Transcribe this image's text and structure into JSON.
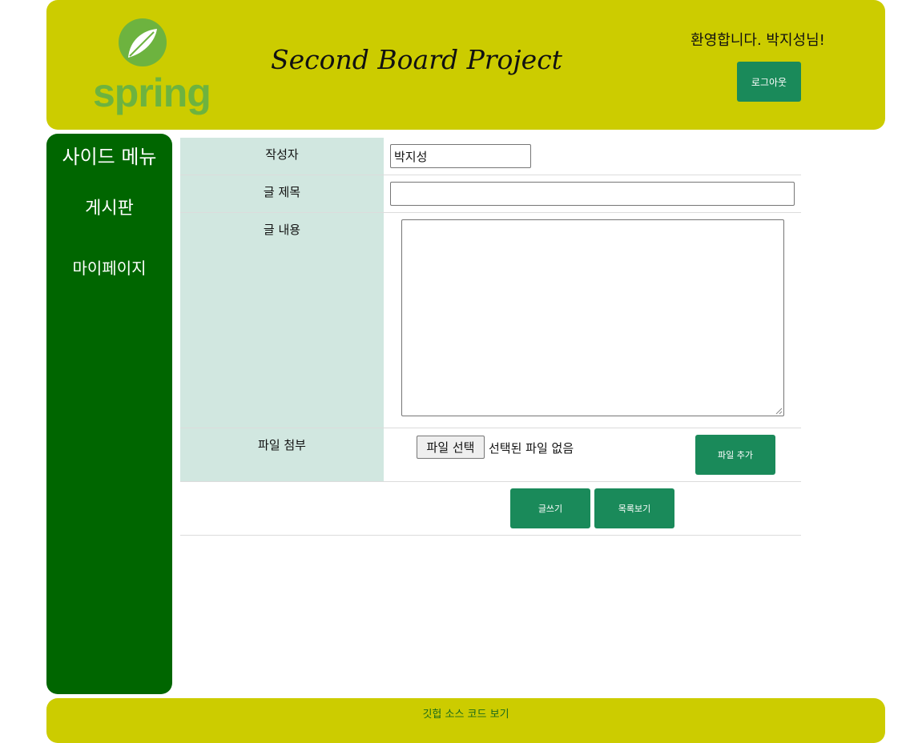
{
  "header": {
    "logo_text": "spring",
    "site_title": "Second Board Project",
    "welcome_text": "환영합니다. 박지성님!",
    "logout_label": "로그아웃"
  },
  "sidebar": {
    "title": "사이드 메뉴",
    "items": [
      {
        "label": "게시판"
      },
      {
        "label": "마이페이지"
      }
    ]
  },
  "form": {
    "writer_label": "작성자",
    "writer_value": "박지성",
    "title_label": "글 제목",
    "title_value": "",
    "content_label": "글 내용",
    "content_value": "",
    "file_label": "파일 첨부",
    "file_choose_label": "파일 선택",
    "file_status": "선택된 파일 없음",
    "add_file_label": "파일 추가",
    "write_label": "글쓰기",
    "list_label": "목록보기"
  },
  "footer": {
    "github_label": "깃헙 소스 코드 보기"
  },
  "colors": {
    "header_bg": "#cccc00",
    "sidebar_bg": "#006600",
    "button_bg": "#1a8a5a",
    "label_cell_bg": "#d1e7e0",
    "spring_green": "#6db33f"
  }
}
